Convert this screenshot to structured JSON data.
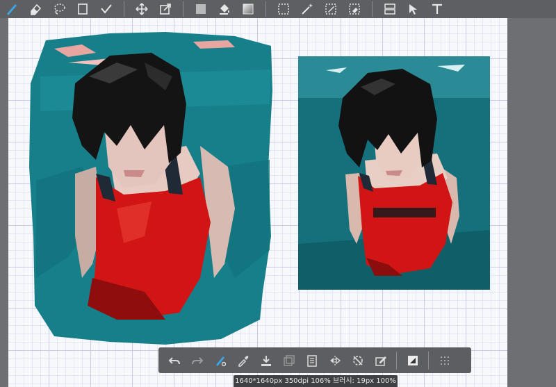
{
  "toolbar": {
    "top_tools": [
      {
        "name": "brush-icon"
      },
      {
        "name": "eraser-icon"
      },
      {
        "name": "lasso-icon"
      },
      {
        "name": "rectangle-icon"
      },
      {
        "name": "check-icon"
      },
      {
        "name": "move-icon"
      },
      {
        "name": "transform-icon"
      },
      {
        "name": "fill-icon"
      },
      {
        "name": "bucket-icon"
      },
      {
        "name": "gradient-icon"
      },
      {
        "name": "marquee-icon"
      },
      {
        "name": "magic-wand-icon"
      },
      {
        "name": "pen-select-icon"
      },
      {
        "name": "erase-select-icon"
      },
      {
        "name": "panel-icon"
      },
      {
        "name": "cursor-icon"
      },
      {
        "name": "text-icon"
      }
    ]
  },
  "bottom_toolbar": {
    "tools": [
      "undo-icon",
      "redo-icon",
      "brush-settings-icon",
      "eyedropper-icon",
      "download-icon",
      "copy-icon",
      "document-icon",
      "flip-icon",
      "rotate-icon",
      "edit-icon",
      "layer-icon",
      "grid-icon"
    ]
  },
  "status_bar": {
    "text": "1640*1640px 350dpi 106% 브러시: 19px 100%"
  },
  "colors": {
    "accent": "#3aa6e8",
    "water": "#167f8a",
    "swimsuit": "#d11515"
  }
}
